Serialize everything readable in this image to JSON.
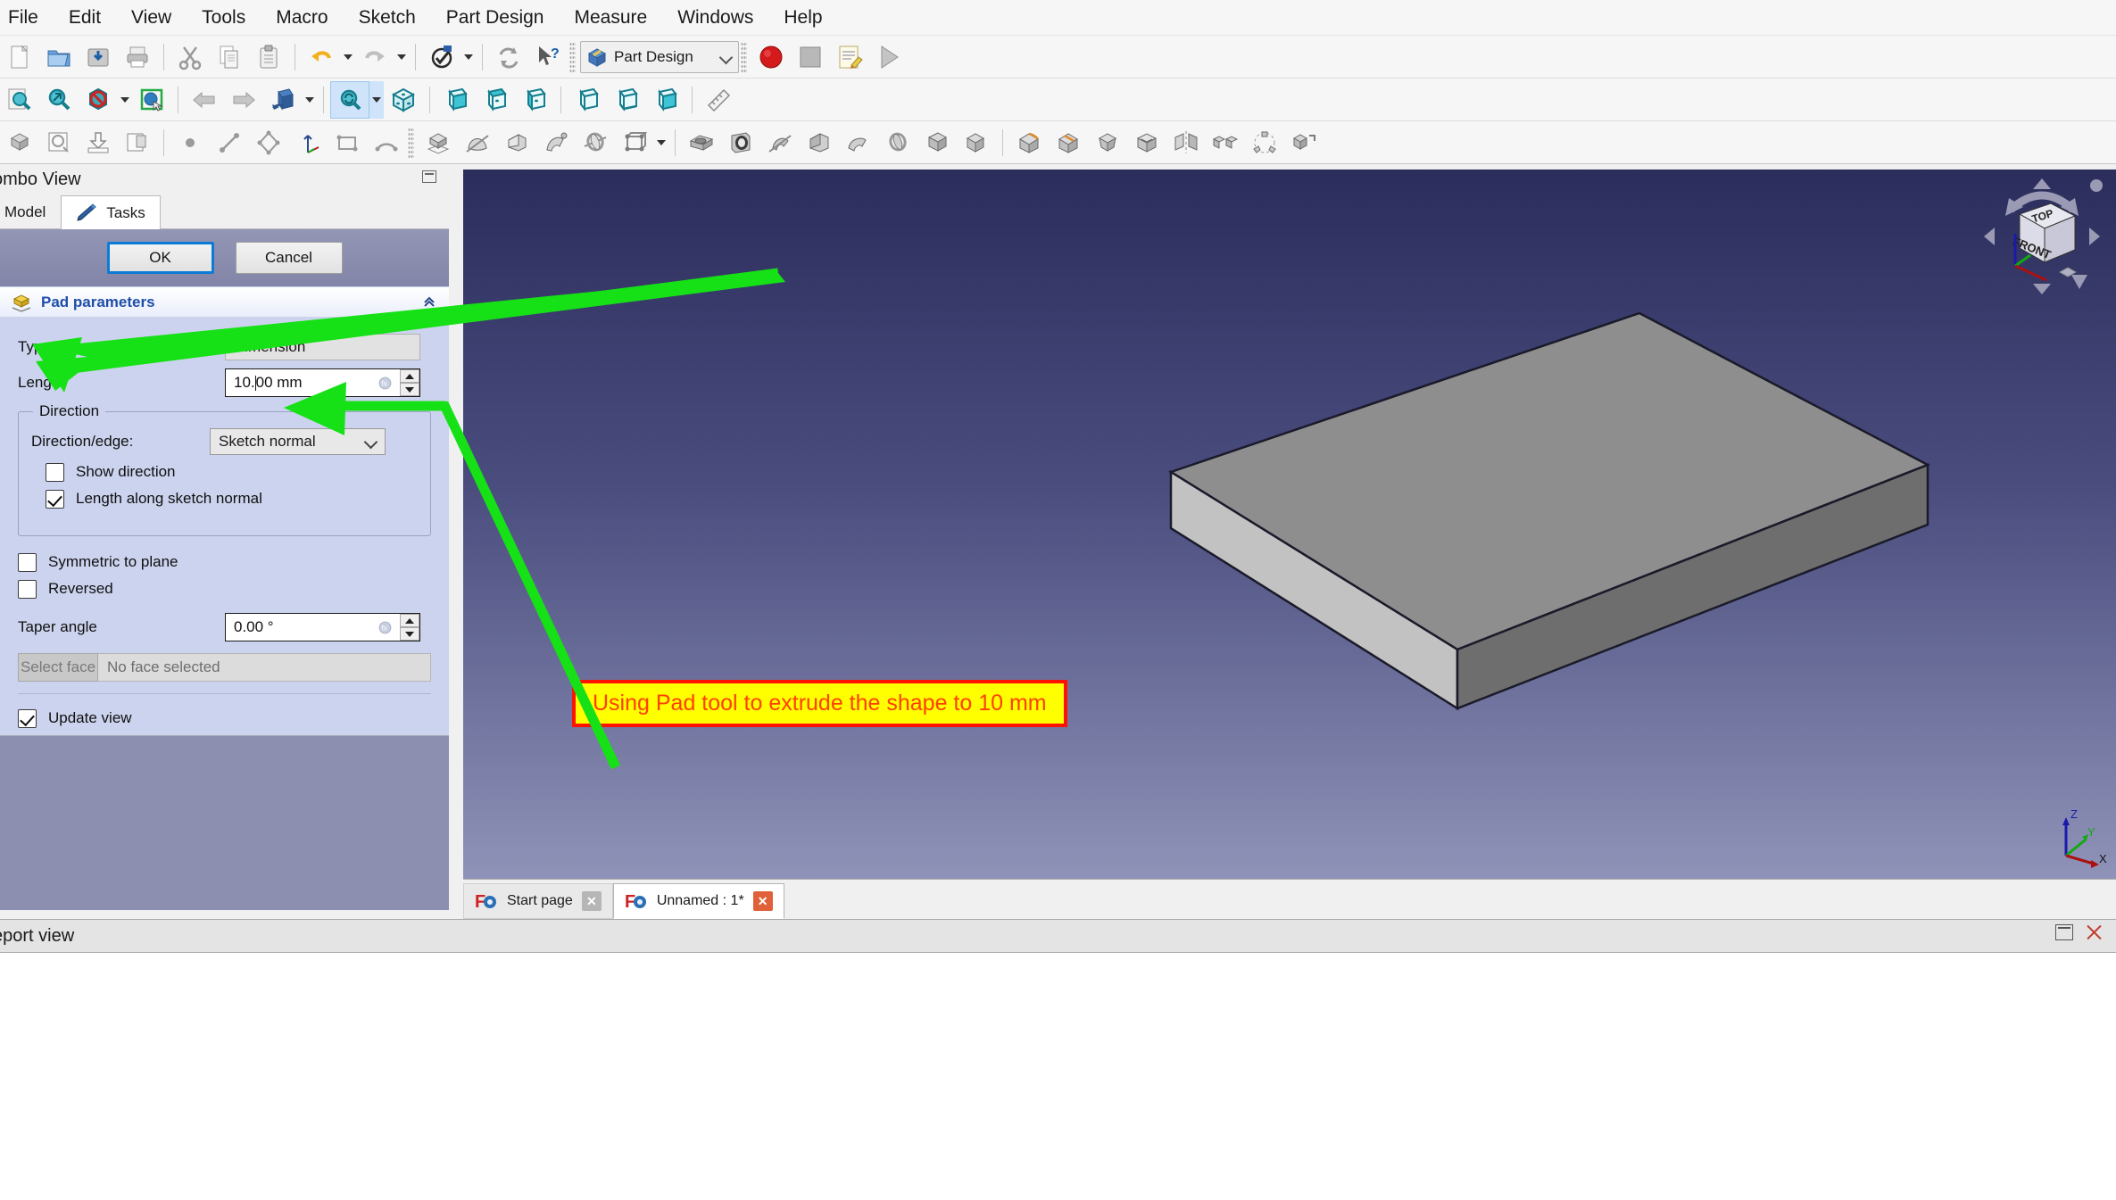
{
  "menu": {
    "items": [
      {
        "label": "File"
      },
      {
        "label": "Edit"
      },
      {
        "label": "View"
      },
      {
        "label": "Tools"
      },
      {
        "label": "Macro"
      },
      {
        "label": "Sketch"
      },
      {
        "label": "Part Design"
      },
      {
        "label": "Measure"
      },
      {
        "label": "Windows"
      },
      {
        "label": "Help"
      }
    ]
  },
  "toolbar_file": {
    "icons": [
      {
        "name": "new-document-icon",
        "title": "New"
      },
      {
        "name": "open-folder-icon",
        "title": "Open"
      },
      {
        "name": "save-icon",
        "title": "Save"
      },
      {
        "name": "print-icon",
        "title": "Print"
      },
      {
        "name": "cut-scissors-icon",
        "title": "Cut"
      },
      {
        "name": "copy-icon",
        "title": "Copy"
      },
      {
        "name": "paste-clipboard-icon",
        "title": "Paste"
      },
      {
        "name": "undo-arrow-icon",
        "title": "Undo"
      },
      {
        "name": "redo-arrow-icon",
        "title": "Redo"
      },
      {
        "name": "refresh-icon",
        "title": "Refresh"
      },
      {
        "name": "whats-this-icon",
        "title": "What's This"
      }
    ]
  },
  "workbench": {
    "selected": "Part Design",
    "icon_name": "part-design-workbench-icon"
  },
  "macro_toolbar": {
    "icons": [
      {
        "name": "macro-record-icon",
        "title": "Macro recording"
      },
      {
        "name": "macro-stop-icon",
        "title": "Stop macro recording"
      },
      {
        "name": "macro-edit-icon",
        "title": "Macros"
      },
      {
        "name": "macro-execute-icon",
        "title": "Execute macro"
      }
    ]
  },
  "toolbar_view": {
    "icons": [
      {
        "name": "fit-all-icon",
        "title": "Fits the whole content on the screen"
      },
      {
        "name": "fit-selection-icon",
        "title": "Fit selection"
      },
      {
        "name": "draw-style-icon",
        "title": "Draw style"
      },
      {
        "name": "box-selection-icon",
        "title": "Box selection"
      },
      {
        "name": "back-arrow-icon",
        "title": "Previous view"
      },
      {
        "name": "forward-arrow-icon",
        "title": "Next view"
      },
      {
        "name": "isometric-view-icon",
        "title": "Axonometric"
      },
      {
        "name": "zoom-sync-icon",
        "title": "Sync view"
      },
      {
        "name": "view-fit-cube-icon",
        "title": "Fit view"
      },
      {
        "name": "view-front-icon",
        "title": "Front"
      },
      {
        "name": "view-top-icon",
        "title": "Top"
      },
      {
        "name": "view-right-icon",
        "title": "Right"
      },
      {
        "name": "view-rear-icon",
        "title": "Rear"
      },
      {
        "name": "view-bottom-icon",
        "title": "Bottom"
      },
      {
        "name": "view-left-icon",
        "title": "Left"
      },
      {
        "name": "measure-ruler-icon",
        "title": "Measure"
      }
    ]
  },
  "toolbar_sketch": {
    "icons": [
      {
        "name": "create-body-icon",
        "title": "Create body"
      },
      {
        "name": "create-sketch-icon",
        "title": "Create sketch"
      },
      {
        "name": "attach-sketch-icon",
        "title": "Attach sketch"
      },
      {
        "name": "validate-sketch-icon",
        "title": "Validate sketch"
      },
      {
        "name": "create-point-icon",
        "title": "Create point"
      },
      {
        "name": "create-line-icon",
        "title": "Create line"
      },
      {
        "name": "create-polyline-icon",
        "title": "Create polyline"
      },
      {
        "name": "create-datum-icon",
        "title": "Create datum"
      },
      {
        "name": "create-rect-icon",
        "title": "Create rectangle"
      },
      {
        "name": "create-arc-icon",
        "title": "Create arc"
      }
    ]
  },
  "toolbar_partdesign": {
    "icons": [
      {
        "name": "pad-icon",
        "title": "Pad"
      },
      {
        "name": "revolution-icon",
        "title": "Revolution"
      },
      {
        "name": "additive-loft-icon",
        "title": "Additive loft"
      },
      {
        "name": "additive-pipe-icon",
        "title": "Additive pipe"
      },
      {
        "name": "additive-helix-icon",
        "title": "Additive helix"
      },
      {
        "name": "additive-primitive-icon",
        "title": "Create an additive primitive"
      },
      {
        "name": "pocket-icon",
        "title": "Pocket"
      },
      {
        "name": "hole-icon",
        "title": "Hole"
      },
      {
        "name": "groove-icon",
        "title": "Groove"
      },
      {
        "name": "subtractive-loft-icon",
        "title": "Subtractive loft"
      },
      {
        "name": "subtractive-pipe-icon",
        "title": "Subtractive pipe"
      },
      {
        "name": "subtractive-helix-icon",
        "title": "Subtractive helix"
      },
      {
        "name": "subtractive-primitive-icon",
        "title": "Create a subtractive primitive"
      },
      {
        "name": "fillet-icon",
        "title": "Fillet"
      },
      {
        "name": "chamfer-icon",
        "title": "Chamfer"
      },
      {
        "name": "draft-icon",
        "title": "Draft"
      },
      {
        "name": "thickness-icon",
        "title": "Thickness"
      },
      {
        "name": "mirrored-icon",
        "title": "Mirrored"
      },
      {
        "name": "linear-pattern-icon",
        "title": "LinearPattern"
      },
      {
        "name": "polar-pattern-icon",
        "title": "PolarPattern"
      },
      {
        "name": "multi-transform-icon",
        "title": "Create MultiTransform"
      },
      {
        "name": "boolean-icon",
        "title": "Boolean operation"
      }
    ]
  },
  "combo_view": {
    "title": "ombo View",
    "tabs": [
      {
        "label": "Model",
        "active": false,
        "name": "tab-model"
      },
      {
        "label": "Tasks",
        "active": true,
        "name": "tab-tasks"
      }
    ]
  },
  "task_panel": {
    "ok_label": "OK",
    "cancel_label": "Cancel",
    "group_title": "Pad parameters",
    "fields": {
      "type_label": "Type",
      "type_value": "Dimension",
      "length_label": "Length",
      "length_value": "10.00 mm",
      "length_value_before_caret": "10.",
      "length_value_after_caret": "00 mm",
      "direction_legend": "Direction",
      "direction_edge_label": "Direction/edge:",
      "direction_edge_value": "Sketch normal",
      "show_direction_label": "Show direction",
      "show_direction_checked": false,
      "length_along_normal_label": "Length along sketch normal",
      "length_along_normal_checked": true,
      "symmetric_label": "Symmetric to plane",
      "symmetric_checked": false,
      "reversed_label": "Reversed",
      "reversed_checked": false,
      "taper_angle_label": "Taper angle",
      "taper_angle_value": "0.00 °",
      "select_face_label": "Select face",
      "face_status": "No face selected",
      "update_view_label": "Update view",
      "update_view_checked": true
    }
  },
  "viewport": {
    "annotation": "Using Pad tool to extrude the shape to 10 mm",
    "annotation_colors": {
      "background": "#ffff00",
      "border": "#ff1200",
      "text": "#ff4000"
    },
    "navcube": {
      "top_face": "TOP",
      "front_face": "FRONT"
    },
    "axis_labels": {
      "x": "X",
      "y": "Y",
      "z": "Z"
    },
    "axis_colors": {
      "x": "#aa1111",
      "y": "#119911",
      "z": "#1a1aaa"
    },
    "model": {
      "shape": "rectangular pad",
      "top_face_color": "#8e8e8e",
      "front_face_color": "#c0c0c0",
      "right_face_color": "#6e6e6e",
      "edge_color": "#1a1a2a"
    }
  },
  "document_tabs": [
    {
      "label": "Start page",
      "active": false,
      "name": "mdi-tab-start-page"
    },
    {
      "label": "Unnamed : 1*",
      "active": true,
      "name": "mdi-tab-unnamed"
    }
  ],
  "report_view": {
    "title": "eport view",
    "content": ""
  }
}
